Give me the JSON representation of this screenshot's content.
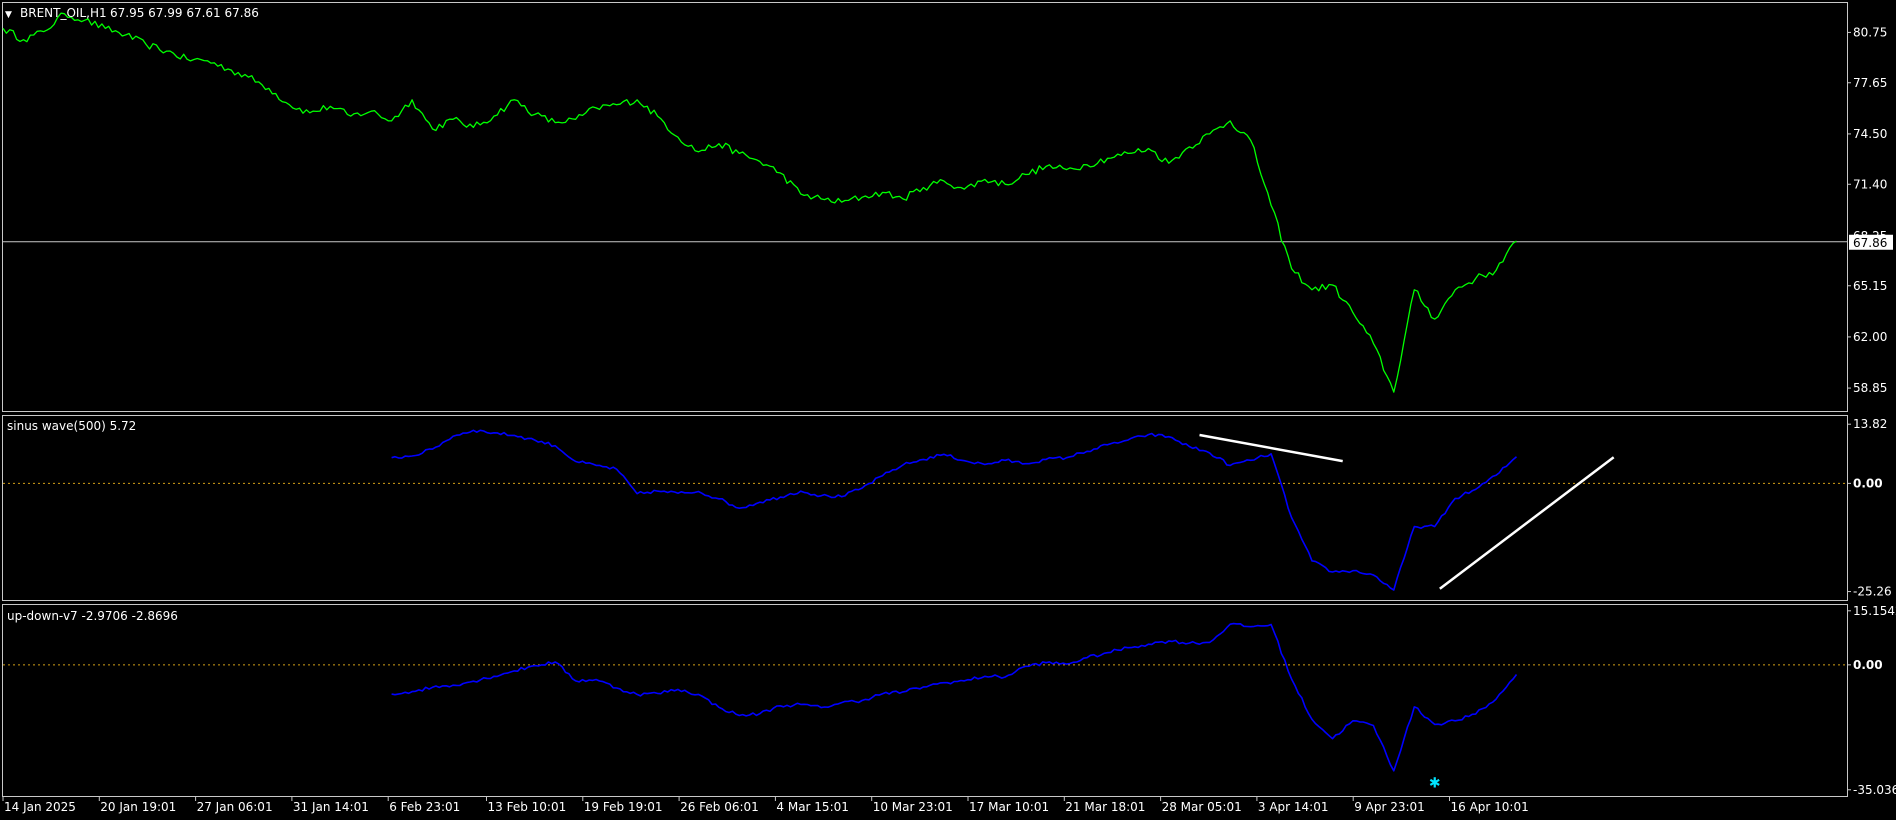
{
  "chart_data": [
    {
      "type": "line",
      "panel": "main",
      "title": "BRENT_OIL,H1",
      "ohlc_text": "67.95 67.99 67.61 67.86",
      "current_price": 67.86,
      "current_price_label": "67.86",
      "line_color": "#00ff00",
      "ylim": [
        57.5,
        82.5
      ],
      "y_ticks": [
        80.75,
        77.65,
        74.5,
        71.4,
        65.15,
        62.0,
        58.85
      ],
      "y_tick_labels": [
        "80.75",
        "77.65",
        "74.50",
        "71.40",
        "65.15",
        "62.00",
        "58.85"
      ],
      "hidden_tick_label": "68.25",
      "x": [
        0,
        2,
        4,
        6,
        8,
        10,
        12,
        14,
        16,
        18,
        20,
        22,
        24,
        26,
        28,
        30,
        32,
        34,
        36,
        38,
        40,
        42,
        44,
        46,
        48,
        50,
        52,
        54,
        56,
        58,
        60,
        62,
        64,
        66,
        68,
        70,
        72,
        74,
        76,
        78,
        80,
        82,
        84,
        86,
        88,
        90,
        92,
        94,
        96,
        98,
        100,
        102,
        104,
        106,
        108,
        110,
        112,
        114,
        116,
        118,
        120,
        122,
        124,
        126,
        128,
        130,
        132,
        134,
        136,
        138,
        140,
        142,
        144,
        146,
        148
      ],
      "y": [
        81.0,
        80.3,
        80.8,
        81.9,
        81.5,
        81.0,
        80.6,
        80.0,
        79.6,
        79.1,
        79.0,
        78.5,
        78.0,
        77.3,
        76.3,
        75.8,
        76.2,
        75.6,
        75.9,
        75.3,
        76.6,
        74.8,
        75.4,
        74.9,
        75.6,
        76.6,
        75.7,
        75.2,
        75.4,
        76.1,
        76.3,
        76.6,
        75.6,
        74.3,
        73.4,
        73.9,
        73.3,
        72.8,
        72.1,
        70.8,
        70.5,
        70.3,
        70.6,
        70.9,
        70.5,
        71.2,
        71.6,
        71.1,
        71.7,
        71.4,
        72.0,
        72.5,
        72.3,
        72.6,
        73.0,
        73.3,
        73.6,
        72.7,
        73.7,
        74.5,
        75.3,
        74.1,
        70.1,
        66.2,
        64.9,
        65.2,
        63.5,
        61.6,
        58.6,
        64.9,
        63.1,
        64.9,
        65.6,
        66.1,
        67.9
      ],
      "x_tick_labels": [
        "14 Jan 2025",
        "20 Jan 19:01",
        "27 Jan 06:01",
        "31 Jan 14:01",
        "6 Feb 23:01",
        "13 Feb 10:01",
        "19 Feb 19:01",
        "26 Feb 06:01",
        "4 Mar 15:01",
        "10 Mar 23:01",
        "17 Mar 10:01",
        "21 Mar 18:01",
        "28 Mar 05:01",
        "3 Apr 14:01",
        "9 Apr 23:01",
        "16 Apr 10:01"
      ]
    },
    {
      "type": "line",
      "panel": "indicator-1",
      "title": "sinus wave(500) 5.72",
      "line_color": "#0000ff",
      "ylim": [
        -27,
        15.5
      ],
      "y_tick_labels": [
        "13.82",
        "0.00",
        "-25.26"
      ],
      "y_ticks": [
        13.82,
        0.0,
        -25.26
      ],
      "zero_line_color": "#d4a017",
      "x": [
        38,
        40,
        42,
        44,
        46,
        48,
        50,
        52,
        54,
        56,
        58,
        60,
        62,
        64,
        66,
        68,
        70,
        72,
        74,
        76,
        78,
        80,
        82,
        84,
        86,
        88,
        90,
        92,
        94,
        96,
        98,
        100,
        102,
        104,
        106,
        108,
        110,
        112,
        114,
        116,
        118,
        120,
        122,
        124,
        126,
        128,
        130,
        132,
        134,
        136,
        138,
        140,
        142,
        144,
        146,
        148
      ],
      "y": [
        6.0,
        6.4,
        8.0,
        11.0,
        12.4,
        11.8,
        11.2,
        10.1,
        8.8,
        5.1,
        4.2,
        3.3,
        -2.4,
        -1.8,
        -2.3,
        -1.9,
        -3.6,
        -5.8,
        -4.4,
        -3.2,
        -1.8,
        -2.9,
        -3.1,
        -1.1,
        1.8,
        4.3,
        5.6,
        6.8,
        5.3,
        4.4,
        5.4,
        4.6,
        5.6,
        6.0,
        7.5,
        9.0,
        10.1,
        11.4,
        10.9,
        8.6,
        7.1,
        4.2,
        5.4,
        6.9,
        -8.0,
        -18.1,
        -20.7,
        -20.4,
        -21.4,
        -24.9,
        -10.1,
        -10.1,
        -3.5,
        -1.4,
        1.9,
        6.2
      ],
      "annotations": [
        {
          "type": "trendline",
          "color": "#ffffff",
          "from": [
            117,
            11.3
          ],
          "to": [
            131,
            5.2
          ]
        },
        {
          "type": "trendline",
          "color": "#ffffff",
          "from": [
            140.5,
            -24.6
          ],
          "to": [
            157.5,
            6.1
          ]
        }
      ]
    },
    {
      "type": "line",
      "panel": "indicator-2",
      "title": "up-down-v7 -2.9706 -2.8696",
      "line_color": "#0000ff",
      "ylim": [
        -36.5,
        16.5
      ],
      "y_tick_labels": [
        "15.1542",
        "0.00",
        "-35.0365"
      ],
      "y_ticks": [
        15.1542,
        0.0,
        -35.0365
      ],
      "zero_line_color": "#d4a017",
      "marker": {
        "x": 140,
        "y": -33.0,
        "color": "#00e5ff",
        "symbol": "✱"
      },
      "x": [
        38,
        40,
        42,
        44,
        46,
        48,
        50,
        52,
        54,
        56,
        58,
        60,
        62,
        64,
        66,
        68,
        70,
        72,
        74,
        76,
        78,
        80,
        82,
        84,
        86,
        88,
        90,
        92,
        94,
        96,
        98,
        100,
        102,
        104,
        106,
        108,
        110,
        112,
        114,
        116,
        118,
        120,
        122,
        124,
        126,
        128,
        130,
        132,
        134,
        136,
        138,
        140,
        142,
        144,
        146,
        148
      ],
      "y": [
        -8.2,
        -7.5,
        -6.3,
        -5.7,
        -4.6,
        -3.2,
        -1.7,
        -0.2,
        0.8,
        -4.5,
        -4.1,
        -6.5,
        -8.3,
        -8.0,
        -6.9,
        -8.3,
        -11.9,
        -14.2,
        -13.7,
        -11.5,
        -11.1,
        -12.0,
        -10.6,
        -10.0,
        -8.1,
        -7.6,
        -6.2,
        -5.0,
        -4.5,
        -3.2,
        -3.4,
        -0.4,
        0.6,
        0.2,
        2.0,
        3.4,
        4.8,
        5.8,
        6.7,
        6.1,
        6.3,
        11.4,
        10.7,
        11.3,
        -4.0,
        -15.3,
        -20.7,
        -15.7,
        -17.0,
        -29.7,
        -11.8,
        -16.7,
        -15.7,
        -13.8,
        -9.6,
        -2.7
      ]
    }
  ]
}
